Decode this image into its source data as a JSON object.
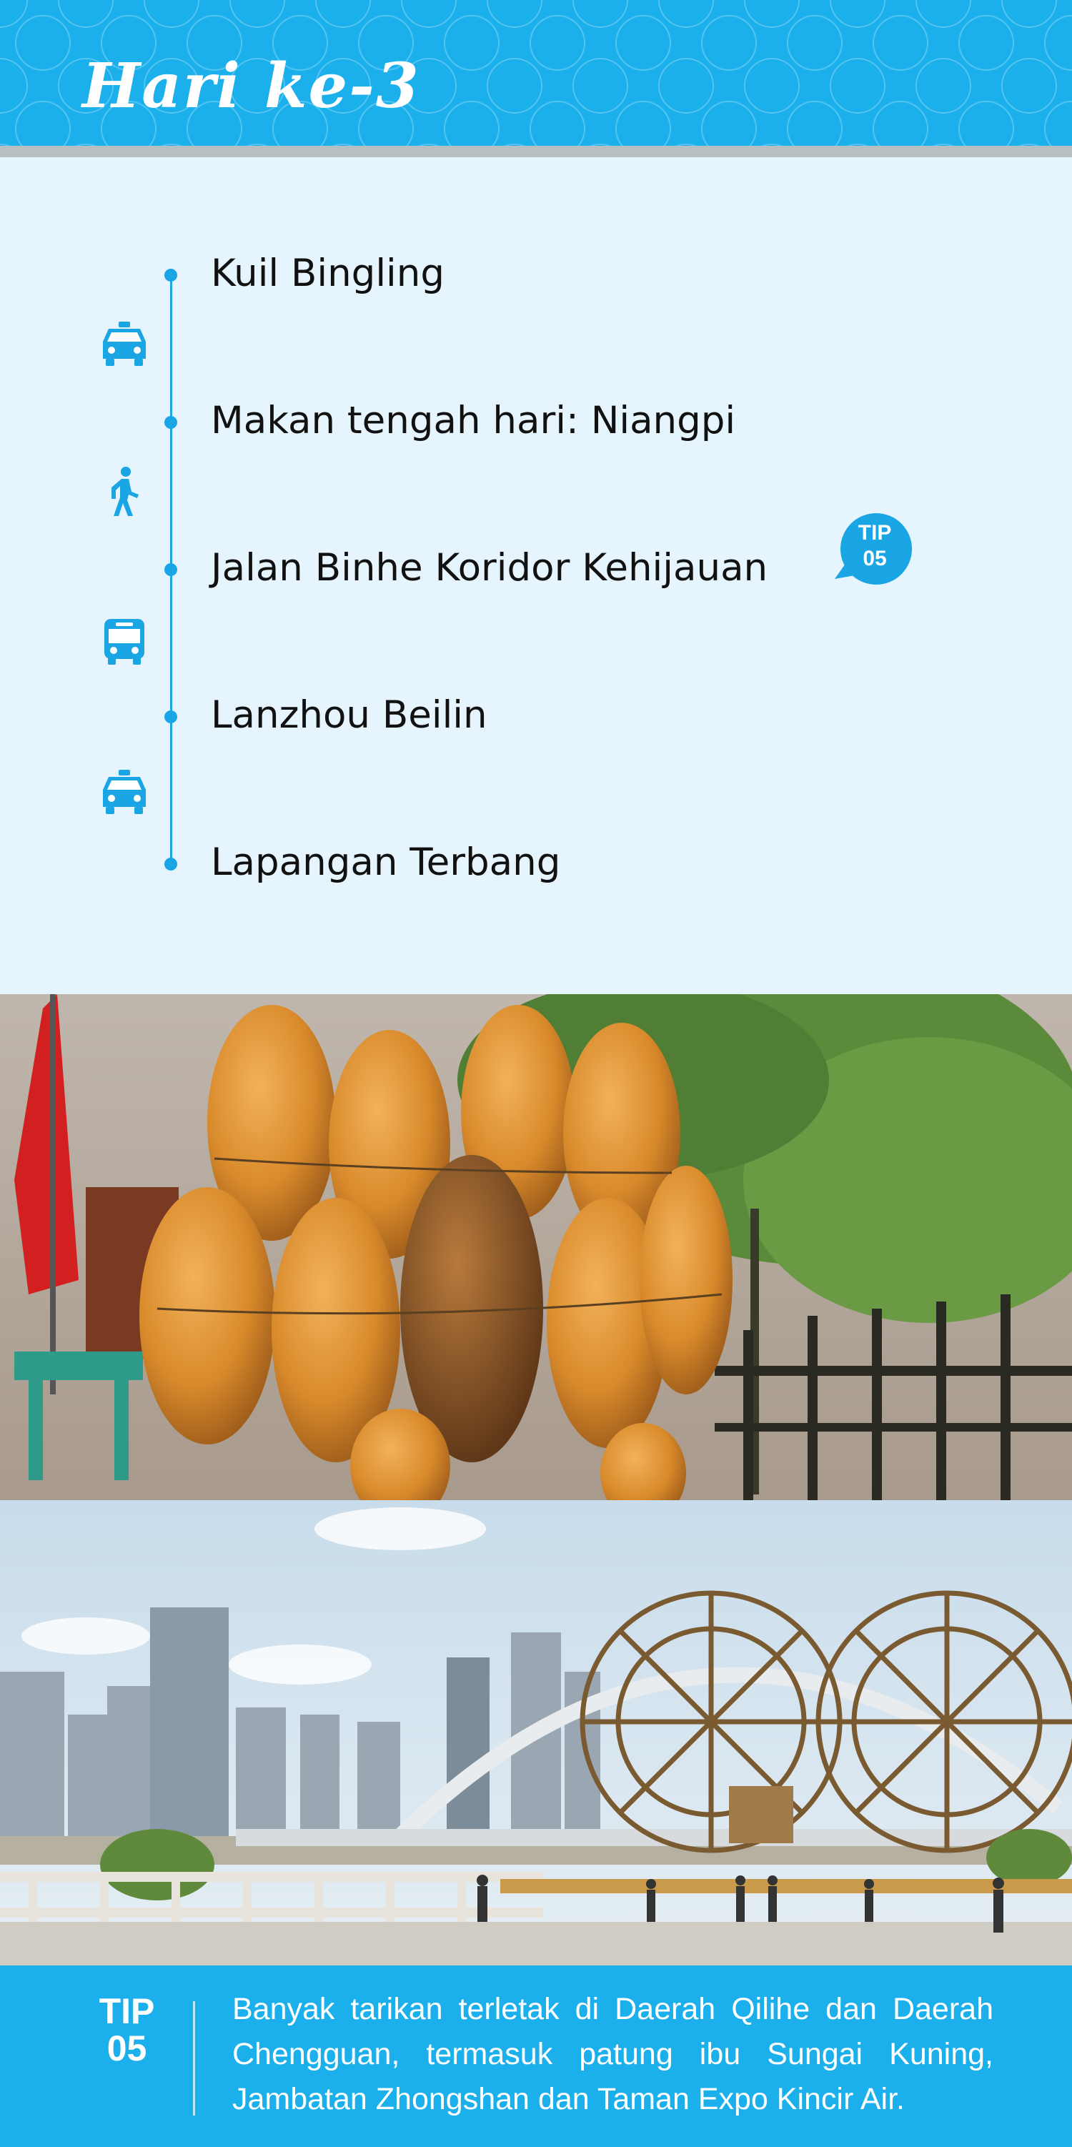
{
  "header": {
    "title": "Hari ke-3"
  },
  "itinerary": {
    "stops": [
      {
        "label": "Kuil Bingling"
      },
      {
        "label": "Makan tengah hari: Niangpi"
      },
      {
        "label": "Jalan Binhe Koridor Kehijauan"
      },
      {
        "label": "Lanzhou Beilin"
      },
      {
        "label": "Lapangan Terbang"
      }
    ],
    "transports": [
      {
        "icon": "taxi-icon"
      },
      {
        "icon": "walking-icon"
      },
      {
        "icon": "bus-icon"
      },
      {
        "icon": "taxi-icon"
      }
    ],
    "tip_bubble": {
      "line1": "TIP",
      "line2": "05"
    }
  },
  "photos": [
    {
      "name": "gourd-rafts-photo"
    },
    {
      "name": "waterwheel-park-photo"
    }
  ],
  "tip_footer": {
    "label_line1": "TIP",
    "label_line2": "05",
    "text": "Banyak tarikan terletak di Daerah Qilihe dan Daerah Chengguan, termasuk patung ibu Sungai Kuning, Jambatan Zhongshan dan Taman Expo Kincir Air."
  },
  "colors": {
    "accent": "#1bb0ec",
    "timeline": "#1aa5e4",
    "background": "#e5f4fd"
  }
}
